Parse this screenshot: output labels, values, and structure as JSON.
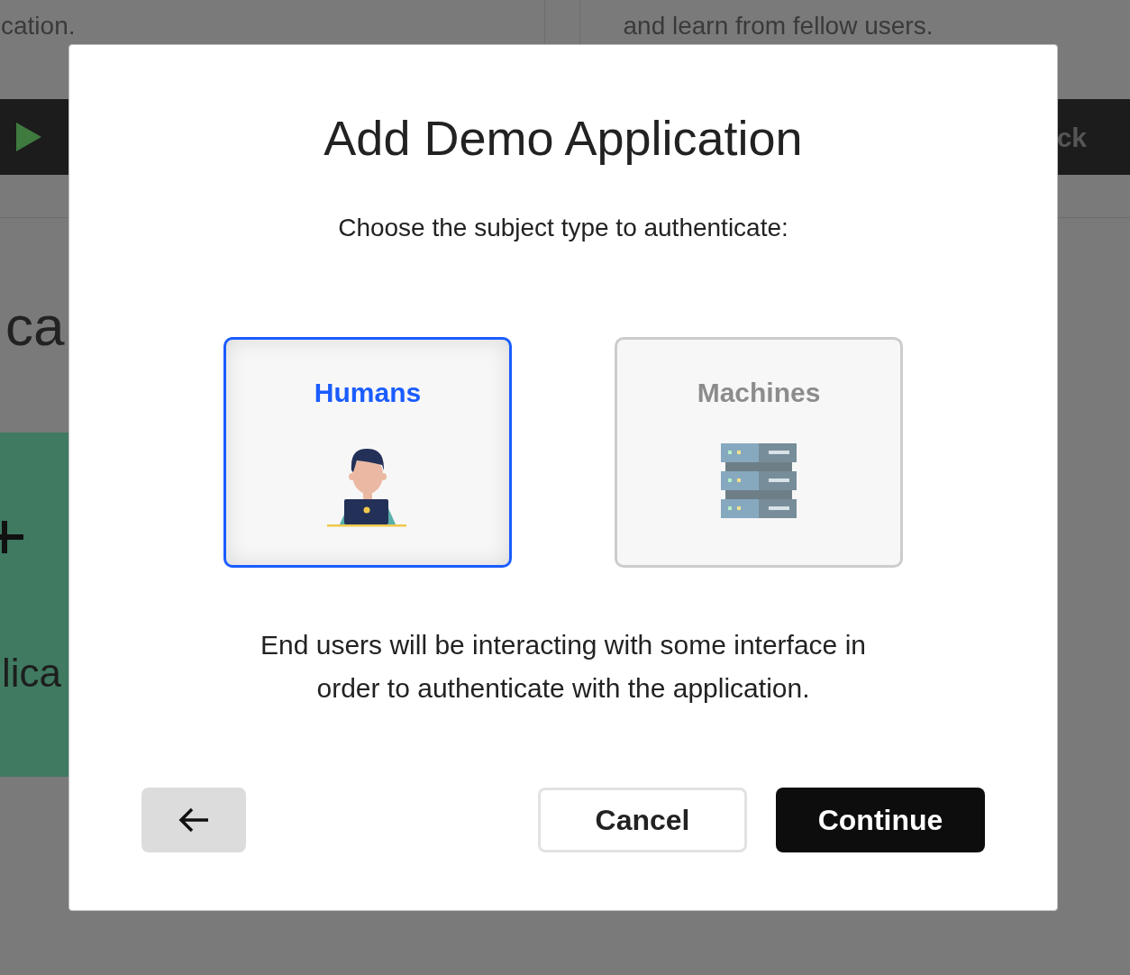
{
  "background": {
    "top_left_text": "cation.",
    "top_right_text": "and learn from fellow users.",
    "toolbar_text": "ck",
    "heading_fragment": "ca",
    "card": {
      "label": "lica"
    }
  },
  "dialog": {
    "title": "Add Demo Application",
    "prompt": "Choose the subject type to authenticate:",
    "options": [
      {
        "kind": "humans",
        "label": "Humans",
        "selected": true
      },
      {
        "kind": "machines",
        "label": "Machines",
        "selected": false
      }
    ],
    "description": "End users will be interacting with some interface in order to authenticate with the application.",
    "buttons": [
      {
        "kind": "back"
      },
      {
        "kind": "secondary",
        "label": "Cancel"
      },
      {
        "kind": "primary",
        "label": "Continue"
      }
    ]
  }
}
